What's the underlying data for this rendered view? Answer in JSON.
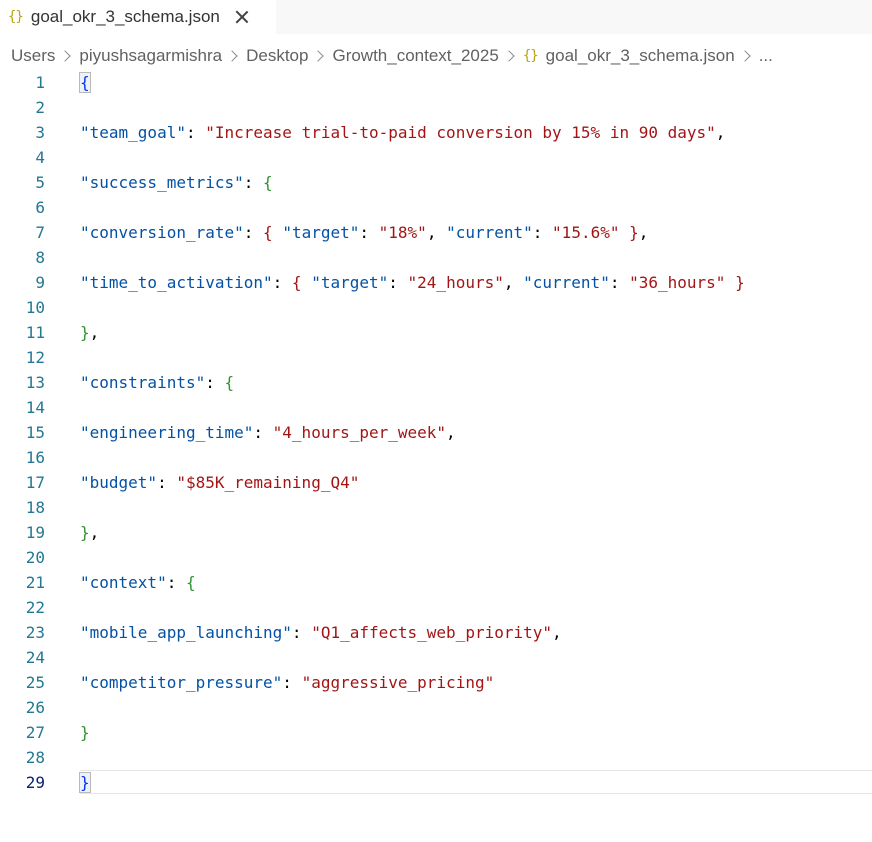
{
  "tab": {
    "icon": "{}",
    "icon_name": "json-braces-icon",
    "label": "goal_okr_3_schema.json"
  },
  "breadcrumb": {
    "items": [
      "Users",
      "piyushsagarmishra",
      "Desktop",
      "Growth_context_2025"
    ],
    "file_icon": "{}",
    "file_label": "goal_okr_3_schema.json",
    "trailing": "..."
  },
  "colors": {
    "key": "#0451a5",
    "string": "#a31515",
    "bracket_level1": "#0431fa",
    "bracket_level2": "#319331",
    "line_number": "#237893",
    "active_line_number": "#0b216f",
    "json_icon": "#b8a614"
  },
  "editor": {
    "active_line": "29",
    "lines": [
      {
        "n": "1",
        "segs": [
          {
            "t": "{",
            "c": "b1",
            "match": true
          }
        ]
      },
      {
        "n": "2",
        "segs": []
      },
      {
        "n": "3",
        "segs": [
          {
            "t": "\"team_goal\"",
            "c": "k"
          },
          {
            "t": ": ",
            "c": "p"
          },
          {
            "t": "\"Increase trial-to-paid conversion by 15% in 90 days\"",
            "c": "s"
          },
          {
            "t": ",",
            "c": "p"
          }
        ]
      },
      {
        "n": "4",
        "segs": []
      },
      {
        "n": "5",
        "segs": [
          {
            "t": "\"success_metrics\"",
            "c": "k"
          },
          {
            "t": ": ",
            "c": "p"
          },
          {
            "t": "{",
            "c": "b2"
          }
        ]
      },
      {
        "n": "6",
        "segs": []
      },
      {
        "n": "7",
        "segs": [
          {
            "t": "\"conversion_rate\"",
            "c": "k"
          },
          {
            "t": ": ",
            "c": "p"
          },
          {
            "t": "{",
            "c": "s"
          },
          {
            "t": " ",
            "c": "p"
          },
          {
            "t": "\"target\"",
            "c": "k"
          },
          {
            "t": ": ",
            "c": "p"
          },
          {
            "t": "\"18%\"",
            "c": "s"
          },
          {
            "t": ", ",
            "c": "p"
          },
          {
            "t": "\"current\"",
            "c": "k"
          },
          {
            "t": ": ",
            "c": "p"
          },
          {
            "t": "\"15.6%\"",
            "c": "s"
          },
          {
            "t": " ",
            "c": "p"
          },
          {
            "t": "}",
            "c": "s"
          },
          {
            "t": ",",
            "c": "p"
          }
        ]
      },
      {
        "n": "8",
        "segs": []
      },
      {
        "n": "9",
        "segs": [
          {
            "t": "\"time_to_activation\"",
            "c": "k"
          },
          {
            "t": ": ",
            "c": "p"
          },
          {
            "t": "{",
            "c": "s"
          },
          {
            "t": " ",
            "c": "p"
          },
          {
            "t": "\"target\"",
            "c": "k"
          },
          {
            "t": ": ",
            "c": "p"
          },
          {
            "t": "\"24_hours\"",
            "c": "s"
          },
          {
            "t": ", ",
            "c": "p"
          },
          {
            "t": "\"current\"",
            "c": "k"
          },
          {
            "t": ": ",
            "c": "p"
          },
          {
            "t": "\"36_hours\"",
            "c": "s"
          },
          {
            "t": " ",
            "c": "p"
          },
          {
            "t": "}",
            "c": "s"
          }
        ]
      },
      {
        "n": "10",
        "segs": []
      },
      {
        "n": "11",
        "segs": [
          {
            "t": "}",
            "c": "b2"
          },
          {
            "t": ",",
            "c": "p"
          }
        ]
      },
      {
        "n": "12",
        "segs": []
      },
      {
        "n": "13",
        "segs": [
          {
            "t": "\"constraints\"",
            "c": "k"
          },
          {
            "t": ": ",
            "c": "p"
          },
          {
            "t": "{",
            "c": "b2"
          }
        ]
      },
      {
        "n": "14",
        "segs": []
      },
      {
        "n": "15",
        "segs": [
          {
            "t": "\"engineering_time\"",
            "c": "k"
          },
          {
            "t": ": ",
            "c": "p"
          },
          {
            "t": "\"4_hours_per_week\"",
            "c": "s"
          },
          {
            "t": ",",
            "c": "p"
          }
        ]
      },
      {
        "n": "16",
        "segs": []
      },
      {
        "n": "17",
        "segs": [
          {
            "t": "\"budget\"",
            "c": "k"
          },
          {
            "t": ": ",
            "c": "p"
          },
          {
            "t": "\"$85K_remaining_Q4\"",
            "c": "s"
          }
        ]
      },
      {
        "n": "18",
        "segs": []
      },
      {
        "n": "19",
        "segs": [
          {
            "t": "}",
            "c": "b2"
          },
          {
            "t": ",",
            "c": "p"
          }
        ]
      },
      {
        "n": "20",
        "segs": []
      },
      {
        "n": "21",
        "segs": [
          {
            "t": "\"context\"",
            "c": "k"
          },
          {
            "t": ": ",
            "c": "p"
          },
          {
            "t": "{",
            "c": "b2"
          }
        ]
      },
      {
        "n": "22",
        "segs": []
      },
      {
        "n": "23",
        "segs": [
          {
            "t": "\"mobile_app_launching\"",
            "c": "k"
          },
          {
            "t": ": ",
            "c": "p"
          },
          {
            "t": "\"Q1_affects_web_priority\"",
            "c": "s"
          },
          {
            "t": ",",
            "c": "p"
          }
        ]
      },
      {
        "n": "24",
        "segs": []
      },
      {
        "n": "25",
        "segs": [
          {
            "t": "\"competitor_pressure\"",
            "c": "k"
          },
          {
            "t": ": ",
            "c": "p"
          },
          {
            "t": "\"aggressive_pricing\"",
            "c": "s"
          }
        ]
      },
      {
        "n": "26",
        "segs": []
      },
      {
        "n": "27",
        "segs": [
          {
            "t": "}",
            "c": "b2"
          }
        ]
      },
      {
        "n": "28",
        "segs": []
      },
      {
        "n": "29",
        "segs": [
          {
            "t": "}",
            "c": "b1",
            "match": true
          }
        ]
      }
    ]
  }
}
